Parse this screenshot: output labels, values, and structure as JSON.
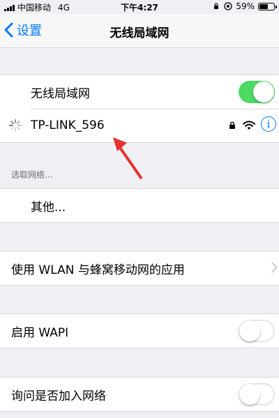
{
  "status_bar": {
    "carrier": "中国移动",
    "network": "4G",
    "time": "下午4:27",
    "battery_percent": "59%",
    "battery_level": 0.59
  },
  "nav": {
    "back_label": "设置",
    "title": "无线局域网"
  },
  "wifi_toggle": {
    "label": "无线局域网",
    "on": true
  },
  "current_network": {
    "name": "TP-LINK_596",
    "locked": true,
    "icons": [
      "spinner-icon",
      "lock-icon",
      "wifi-icon",
      "info-icon"
    ]
  },
  "choose_network": {
    "header": "选取网络...",
    "other_label": "其他..."
  },
  "wlan_apps": {
    "label": "使用 WLAN 与蜂窝移动网的应用"
  },
  "wapi": {
    "label": "启用 WAPI",
    "on": false
  },
  "ask_join": {
    "label": "询问是否加入网络",
    "on": false
  },
  "colors": {
    "accent": "#007aff",
    "toggle_on": "#4cd964",
    "background": "#efeff4",
    "arrow": "#e5322d"
  }
}
